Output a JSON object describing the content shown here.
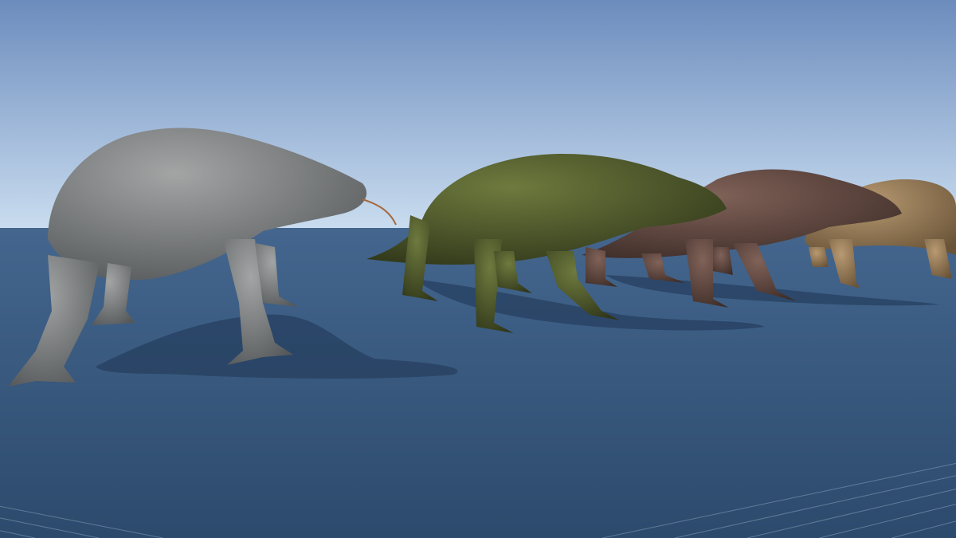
{
  "scene": {
    "sky_top": "#6c8cbd",
    "sky_horizon": "#c9dcef",
    "ground_near": "#2c4a6c",
    "ground_far": "#44668e",
    "grid_line": "#8aa3bf",
    "shadow": "#263f5f"
  },
  "creatures": [
    {
      "name": "grey-lizard",
      "skin": "#7d7f80",
      "dark": "#4f5152"
    },
    {
      "name": "green-lizard",
      "skin": "#4f5a2c",
      "dark": "#2f3619"
    },
    {
      "name": "brown-lizard",
      "skin": "#6a5148",
      "dark": "#3e2d28"
    },
    {
      "name": "tan-lizard",
      "skin": "#a08460",
      "dark": "#6a5438"
    }
  ]
}
